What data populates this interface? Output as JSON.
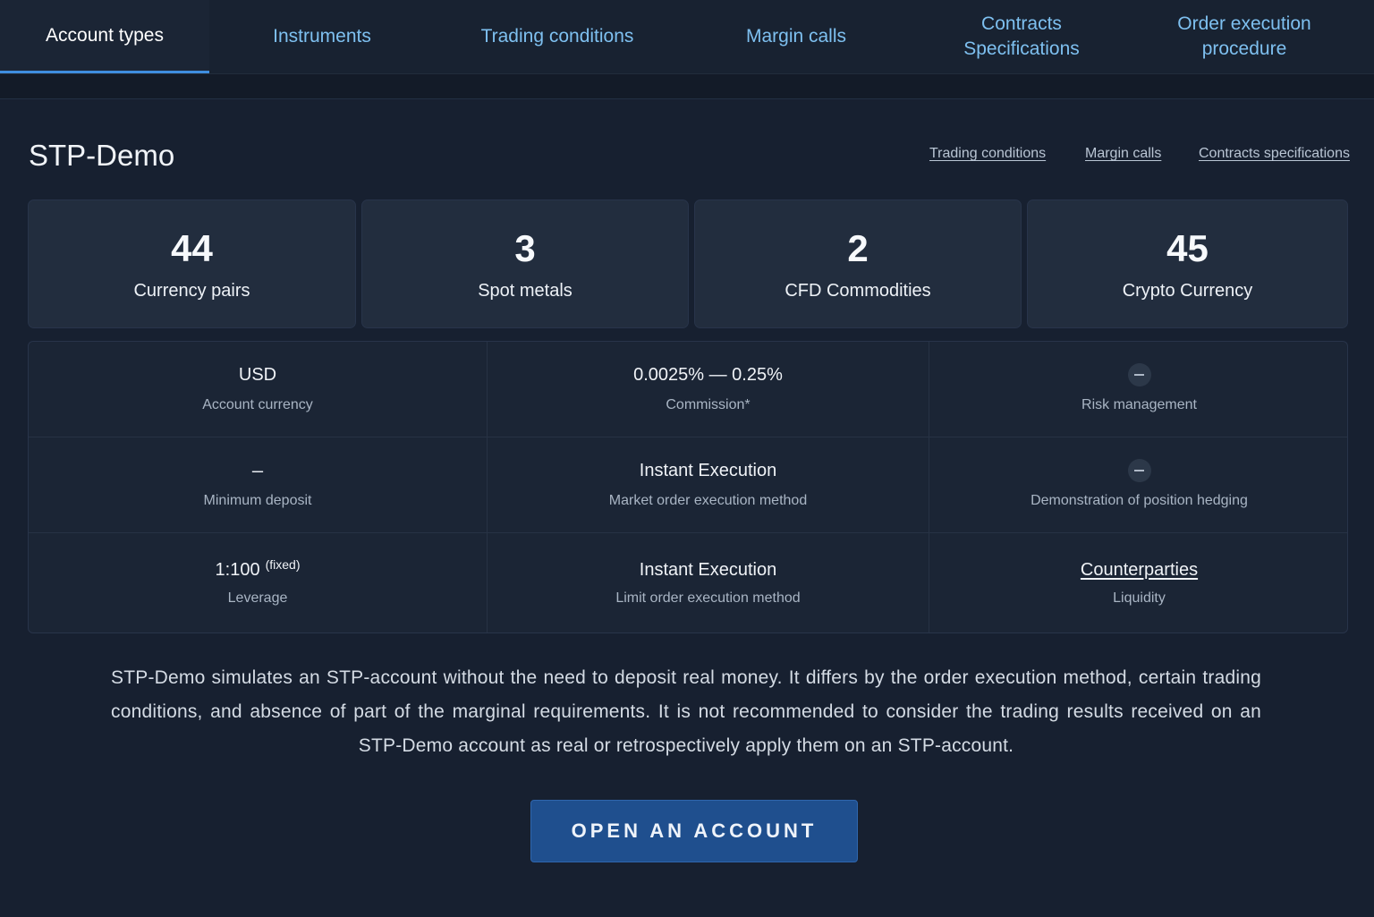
{
  "tabs": [
    {
      "label": "Account types",
      "active": true
    },
    {
      "label": "Instruments",
      "active": false
    },
    {
      "label": "Trading conditions",
      "active": false
    },
    {
      "label": "Margin calls",
      "active": false
    },
    {
      "label": "Contracts\nSpecifications",
      "active": false
    },
    {
      "label": "Order execution\nprocedure",
      "active": false
    }
  ],
  "account": {
    "title": "STP-Demo",
    "links": [
      "Trading conditions",
      "Margin calls",
      "Contracts specifications"
    ]
  },
  "stats": [
    {
      "value": "44",
      "label": "Currency pairs"
    },
    {
      "value": "3",
      "label": "Spot metals"
    },
    {
      "value": "2",
      "label": "CFD Commodities"
    },
    {
      "value": "45",
      "label": "Crypto Currency"
    }
  ],
  "details": {
    "account_currency": {
      "value": "USD",
      "label": "Account currency"
    },
    "commission": {
      "value": "0.0025% — 0.25%",
      "label": "Commission*"
    },
    "risk_management": {
      "icon": "minus-icon",
      "label": "Risk management"
    },
    "minimum_deposit": {
      "value": "–",
      "label": "Minimum deposit"
    },
    "market_order": {
      "value": "Instant Execution",
      "label": "Market order execution method"
    },
    "hedging": {
      "icon": "minus-icon",
      "label": "Demonstration of position hedging"
    },
    "leverage": {
      "value": "1:100",
      "note": "(fixed)",
      "label": "Leverage"
    },
    "limit_order": {
      "value": "Instant Execution",
      "label": "Limit order execution method"
    },
    "liquidity": {
      "value": "Counterparties",
      "label": "Liquidity"
    }
  },
  "description": "STP-Demo simulates an STP-account without the need to deposit real money. It differs by the order execution method, certain trading conditions, and absence of part of the marginal requirements. It is not recommended to consider the trading results received on an STP-Demo account as real or retrospectively apply them on an STP-account.",
  "cta": {
    "label": "OPEN AN ACCOUNT"
  },
  "colors": {
    "accent": "#3f8ee0",
    "tab_link": "#7ec0f0",
    "button": "#1f4f8e",
    "background": "#131b28"
  }
}
